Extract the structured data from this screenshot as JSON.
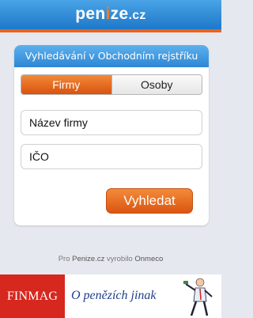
{
  "header": {
    "logo_part1": "pen",
    "logo_accent": "i",
    "logo_part2": "ze",
    "logo_tld": ".cz"
  },
  "panel": {
    "title": "Vyhledávání v Obchodním rejstříku",
    "tabs": [
      {
        "label": "Firmy",
        "active": true
      },
      {
        "label": "Osoby",
        "active": false
      }
    ],
    "fields": [
      {
        "placeholder": "Název firmy"
      },
      {
        "placeholder": "IČO"
      }
    ]
  },
  "search_button": {
    "label": "Vyhledat"
  },
  "footer": {
    "prefix": "Pro",
    "site": "Penize.cz",
    "middle": "vyrobilo",
    "company": "Onmeco"
  },
  "banner": {
    "left_text": "FINMAG",
    "right_text": "O penězích jinak",
    "figure_icon": "person-figure-icon"
  },
  "colors": {
    "header_blue": "#1d78c9",
    "accent_orange": "#e8631e",
    "banner_red": "#d6281f",
    "banner_text_blue": "#1f3f8b"
  }
}
